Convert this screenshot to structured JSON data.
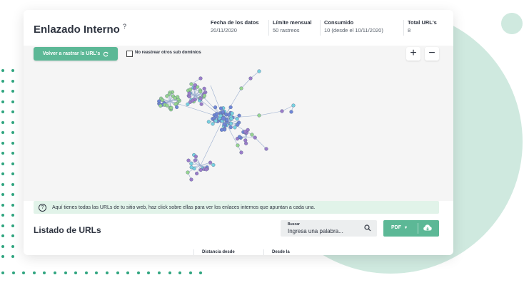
{
  "page": {
    "title": "Enlazado Interno",
    "title_info_symbol": "?",
    "stats": [
      {
        "label": "Fecha de los datos",
        "value": "20/11/2020"
      },
      {
        "label": "Límite mensual",
        "value": "50 rastreos"
      },
      {
        "label": "Consumido",
        "value": "10 (desde el 10/11/2020)"
      },
      {
        "label": "Total URL's",
        "value": "8"
      }
    ]
  },
  "controls": {
    "recrawl_label": "Volver a rastrar ls URL's",
    "recrawl_icon": "refresh-icon",
    "no_subdomains_label": "No reastrear otros sub dominios",
    "no_subdomains_checked": false,
    "zoom_in": "+",
    "zoom_out": "−"
  },
  "info_bar": {
    "icon": "help-circle-icon",
    "text": "Aquí tienes todas las URLs de tu sitio web, haz click sobre ellas para ver los enlaces internos que apuntan a cada una."
  },
  "list": {
    "title": "Listado de URLs",
    "search_label": "Buscar",
    "search_placeholder": "Ingresa una palabra...",
    "pdf_label": "PDF",
    "pdf_icon": "chevron-down-icon",
    "download_icon": "cloud-download-icon",
    "columns": [
      "Distancia desde",
      "Desde la"
    ]
  },
  "colors": {
    "accent": "#5cb896",
    "info_bg": "#e1f3e9",
    "background_circle": "#cfe9df",
    "dot": "#2fa57f",
    "node_blue": "#6f86d6",
    "node_green": "#96d48f",
    "node_purple": "#9b7cc9",
    "node_cyan": "#77d1e0",
    "edge": "#9aaecf"
  }
}
